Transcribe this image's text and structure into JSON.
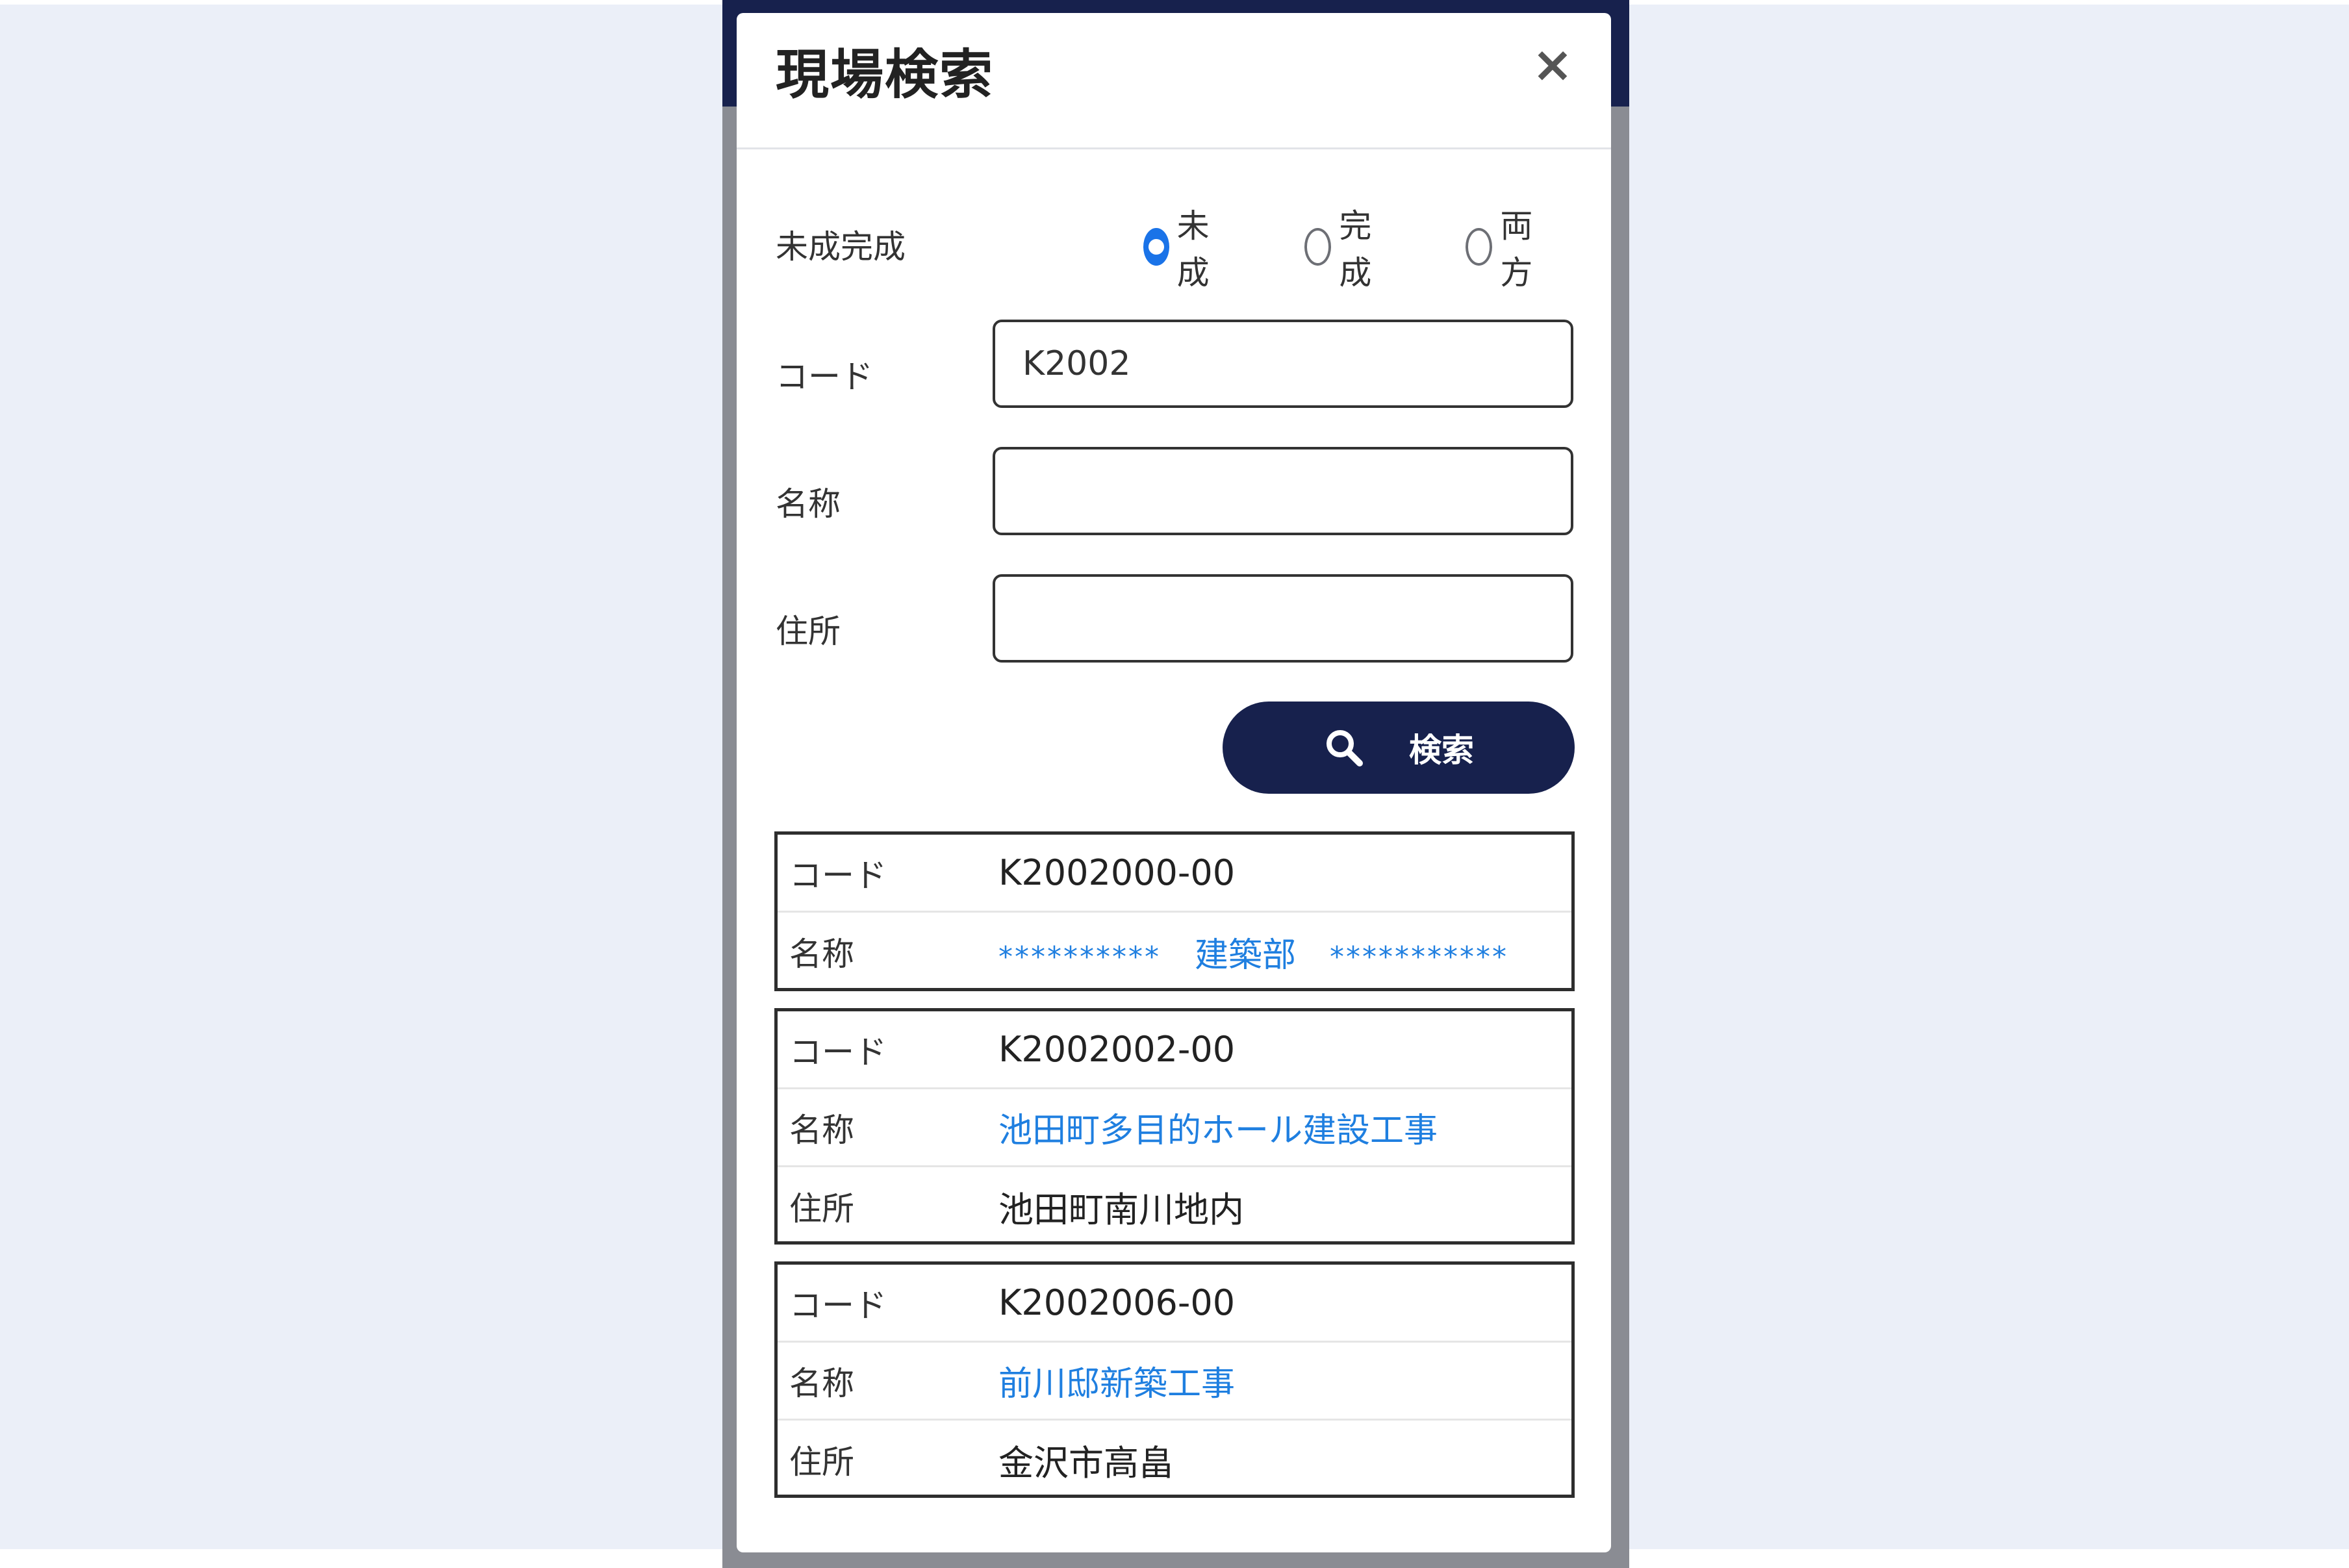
{
  "modal": {
    "title": "現場検索",
    "close_label": "×"
  },
  "form": {
    "status_label": "未成完成",
    "status_options": [
      {
        "label": "未成",
        "checked": true
      },
      {
        "label": "完成",
        "checked": false
      },
      {
        "label": "両方",
        "checked": false
      }
    ],
    "code_label": "コード",
    "code_value": "K2002",
    "name_label": "名称",
    "name_value": "",
    "address_label": "住所",
    "address_value": "",
    "search_button_label": "検索",
    "search_icon": "search-icon"
  },
  "results": [
    {
      "code_key": "コード",
      "code": "K2002000-00",
      "name_key": "名称",
      "name_mask_left": "**********",
      "name_middle": "建築部",
      "name_mask_right": "***********"
    },
    {
      "code_key": "コード",
      "code": "K2002002-00",
      "name_key": "名称",
      "name": "池田町多目的ホール建設工事",
      "address_key": "住所",
      "address": "池田町南川地内"
    },
    {
      "code_key": "コード",
      "code": "K2002006-00",
      "name_key": "名称",
      "name": "前川邸新築工事",
      "address_key": "住所",
      "address": "金沢市高畠"
    }
  ],
  "colors": {
    "navy": "#17214d",
    "link": "#1f7fe0",
    "radio_active": "#1a73e8",
    "page_bg": "#ebeff8"
  }
}
